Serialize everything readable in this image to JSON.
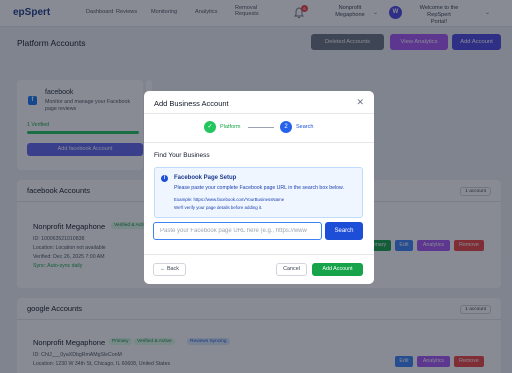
{
  "nav": {
    "logo": "epSpert",
    "links": [
      "Dashboard",
      "Reviews",
      "Monitoring",
      "Analytics"
    ],
    "removal_line1": "Removal",
    "removal_line2": "Requests",
    "bell_count": "6",
    "org_line1": "Nonprofit",
    "org_line2": "Megaphone",
    "avatar_initial": "W",
    "welcome_line1": "Welcome to the RepSpert",
    "welcome_line2": "Portal!"
  },
  "page": {
    "title": "Platform Accounts",
    "deleted_button": "Deleted Accounts",
    "analytics_button": "View Analytics",
    "add_button": "Add Account"
  },
  "facebook_card": {
    "name": "facebook",
    "description": "Monitor and manage your Facebook page reviews",
    "verified": "1 Verified",
    "add_button": "Add facebook Account"
  },
  "facebook_section": {
    "title": "facebook Accounts",
    "count": "1 account",
    "account": {
      "name": "Nonprofit Megaphone",
      "badge": "Verified & Active",
      "id": "ID: 100063521010838",
      "location": "Location: Location not available",
      "verified": "Verified: Dec 26, 2025 7:00 AM",
      "sync": "Sync: Auto-sync daily",
      "primary_btn": "Primary",
      "edit_btn": "Edit",
      "analytics_btn": "Analytics",
      "remove_btn": "Remove"
    }
  },
  "google_section": {
    "title": "google Accounts",
    "count": "1 account",
    "account": {
      "name": "Nonprofit Megaphone",
      "primary_badge": "Primary",
      "verified_badge": "Verified & Active",
      "syncing_badge": "Reviews Syncing",
      "id": "ID: ChIJ___0yaXDbgRmAMgSleConM",
      "location": "Location: 1230 W 34th St, Chicago, IL 60608, United States",
      "edit_btn": "Edit",
      "analytics_btn": "Analytics",
      "remove_btn": "Remove"
    }
  },
  "modal": {
    "title": "Add Business Account",
    "step1_label": "Platform",
    "step2_number": "2",
    "step2_label": "Search",
    "find_title": "Find Your Business",
    "info_title": "Facebook Page Setup",
    "info_desc": "Please paste your complete Facebook page URL in the search box below.",
    "info_example": "Example: https://www.facebook.com/YourBusinessName",
    "info_note": "We'll verify your page details before adding it.",
    "input_placeholder": "Paste your Facebook page URL here (e.g., https://www",
    "search_button": "Search",
    "back_button": "← Back",
    "cancel_button": "Cancel",
    "add_button": "Add Account"
  },
  "colors": {
    "primary": "#4f46e5",
    "analytics": "#a855f7",
    "success": "#16a34a",
    "danger": "#ef4444",
    "info_blue": "#1d4ed8"
  },
  "icons": [
    "bell-icon",
    "facebook-icon",
    "check-icon",
    "info-icon",
    "close-icon",
    "chevron-down-icon"
  ]
}
